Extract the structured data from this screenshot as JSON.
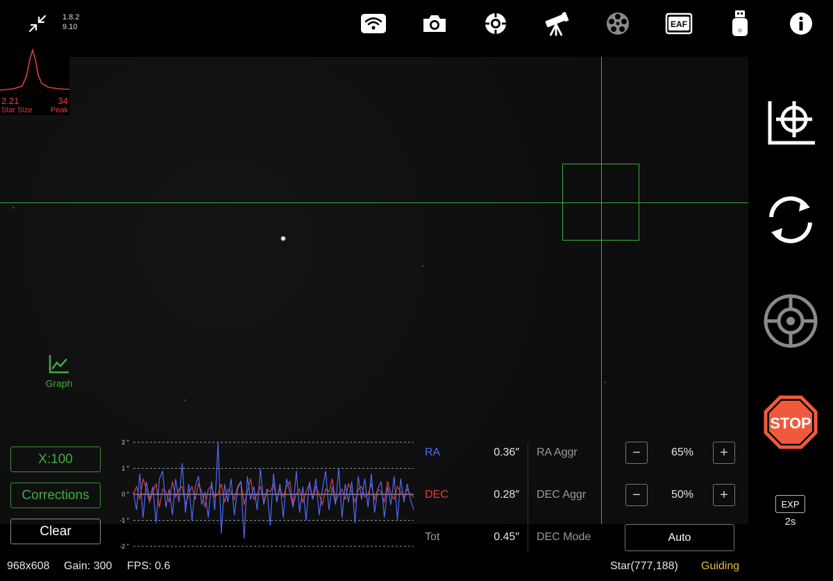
{
  "app": {
    "version_line1": "1.8.2",
    "version_line2": "9.10"
  },
  "toolbar": {
    "icons": [
      "collapse-icon",
      "wifi-icon",
      "camera-icon",
      "guide-icon",
      "telescope-icon",
      "filter-wheel-icon",
      "eaf-icon",
      "usb-drive-icon",
      "info-icon"
    ],
    "eaf_label": "EAF"
  },
  "star_profile": {
    "star_size": "2.21",
    "star_size_label": "Star Size",
    "peak": "34",
    "peak_label": "Peak"
  },
  "graph_toggle": {
    "label": "Graph"
  },
  "side_buttons": {
    "icons": [
      "calibrate-target-icon",
      "loop-icon",
      "guide-target-icon",
      "stop-icon"
    ],
    "stop_label": "STOP"
  },
  "exposure": {
    "badge": "EXP",
    "value": "2s"
  },
  "graph_panel": {
    "zoom_button": "X:100",
    "corrections_button": "Corrections",
    "clear_button": "Clear",
    "y_ticks": [
      "2 ″",
      "1 ″",
      "0 ″",
      "-1 ″",
      "-2 ″"
    ]
  },
  "stats": {
    "ra_label": "RA",
    "ra_value": "0.36″",
    "dec_label": "DEC",
    "dec_value": "0.28″",
    "tot_label": "Tot",
    "tot_value": "0.45″"
  },
  "settings": {
    "ra_aggr_label": "RA Aggr",
    "ra_aggr_value": "65%",
    "dec_aggr_label": "DEC Aggr",
    "dec_aggr_value": "50%",
    "dec_mode_label": "DEC Mode",
    "dec_mode_value": "Auto",
    "minus": "−",
    "plus": "+"
  },
  "status_bar": {
    "resolution": "968x608",
    "gain": "Gain: 300",
    "fps": "FPS: 0.6",
    "star": "Star(777,188)",
    "state": "Guiding"
  },
  "colors": {
    "accent_green": "#3fae3f",
    "ra_blue": "#4d6cff",
    "dec_red": "#e0413a",
    "guiding_yellow": "#e8b84a",
    "stop_orange": "#f05a3c"
  },
  "chart_data": {
    "type": "line",
    "ylim": [
      -2,
      2
    ],
    "series": [
      {
        "name": "RA",
        "values": [
          0.1,
          -0.6,
          0.8,
          -0.9,
          0.5,
          -0.2,
          0.3,
          -1.1,
          0.6,
          0.9,
          -0.5,
          0.2,
          -0.8,
          0.6,
          -0.3,
          1.2,
          -0.7,
          0.4,
          -1.0,
          0.3,
          0.7,
          -0.4,
          0.1,
          -0.9,
          0.5,
          -0.6,
          2.0,
          -1.5,
          0.4,
          -0.3,
          0.6,
          -0.8,
          0.2,
          0.5,
          -1.7,
          0.7,
          -0.2,
          0.3,
          -0.6,
          1.0,
          -0.4,
          0.2,
          -1.2,
          0.8,
          -0.3,
          0.4,
          -0.9,
          0.6,
          0.1,
          -0.5,
          0.9,
          -0.7,
          0.3,
          -1.0,
          0.5,
          -0.2,
          0.6,
          -0.8,
          0.2,
          0.9,
          -0.6,
          0.3,
          -0.4,
          1.0,
          -0.9,
          0.4,
          -0.3,
          0.5,
          -1.1,
          0.7,
          -0.2,
          0.6,
          -0.5,
          0.8,
          -0.7,
          0.2,
          0.5,
          -0.9,
          0.3,
          -0.4,
          0.7,
          -1.0,
          0.6,
          -0.3,
          0.4,
          -0.2,
          -0.6
        ]
      },
      {
        "name": "DEC",
        "values": [
          0.0,
          0.3,
          -0.2,
          0.6,
          0.2,
          -0.3,
          0.1,
          0.4,
          -0.5,
          0.2,
          0.1,
          -0.3,
          0.5,
          -0.1,
          0.2,
          0.3,
          -0.4,
          0.0,
          0.3,
          -0.2,
          0.4,
          0.1,
          -0.5,
          0.2,
          0.3,
          -0.1,
          0.0,
          0.4,
          -0.3,
          0.2,
          0.1,
          -0.2,
          0.3,
          0.5,
          -0.4,
          0.1,
          0.6,
          -0.2,
          0.0,
          0.3,
          -0.3,
          0.2,
          0.1,
          0.4,
          -0.2,
          0.2,
          -0.1,
          0.3,
          0.5,
          -0.4,
          0.0,
          0.2,
          -0.3,
          0.1,
          0.4,
          -0.2,
          0.3,
          0.0,
          -0.4,
          0.2,
          0.1,
          0.6,
          -0.3,
          0.0,
          0.2,
          -0.2,
          0.4,
          0.1,
          -0.3,
          0.2,
          0.3,
          -0.1,
          0.0,
          0.4,
          -0.2,
          0.2,
          0.1,
          -0.3,
          0.5,
          0.0,
          -0.2,
          0.3,
          0.1,
          -0.1,
          0.2,
          0.0,
          -0.1
        ]
      }
    ]
  }
}
